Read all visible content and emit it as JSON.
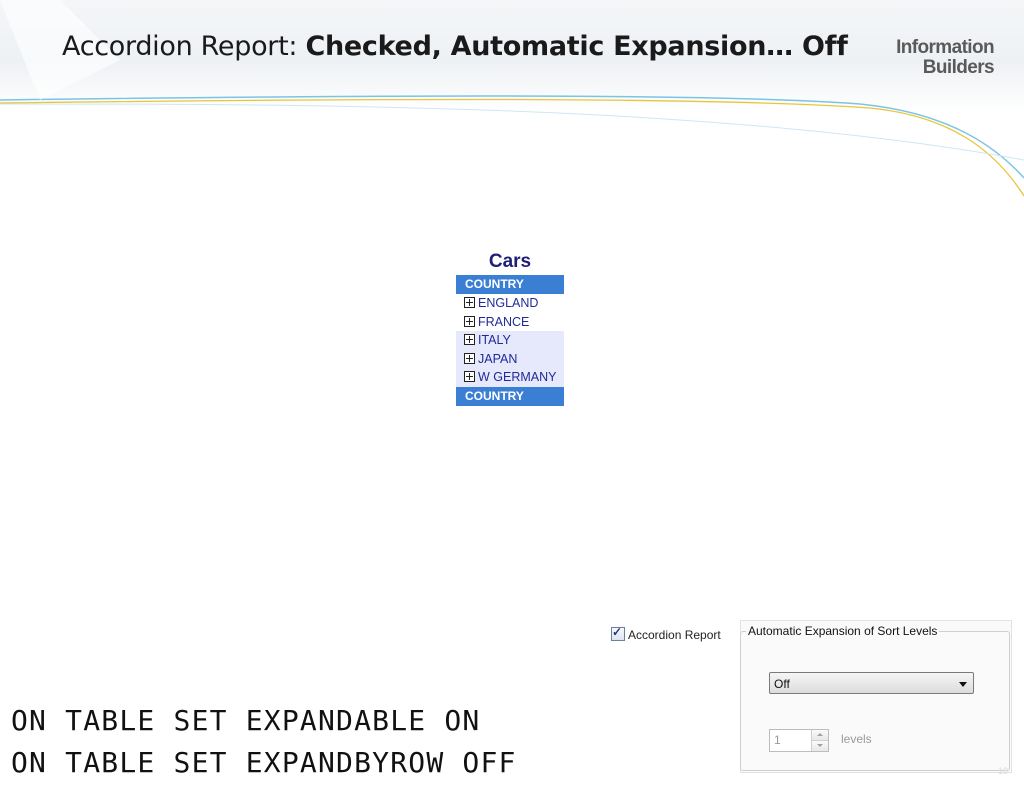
{
  "slide": {
    "title_regular": "Accordion Report: ",
    "title_bold": "Checked, Automatic Expansion… Off",
    "logo": [
      "Information",
      "Builders"
    ],
    "page_number": "18"
  },
  "report": {
    "title": "Cars",
    "header_label": "COUNTRY",
    "footer_label": "COUNTRY",
    "rows": [
      {
        "label": "ENGLAND"
      },
      {
        "label": "FRANCE"
      },
      {
        "label": "ITALY"
      },
      {
        "label": "JAPAN"
      },
      {
        "label": "W GERMANY"
      }
    ]
  },
  "settings": {
    "accordion_checkbox_label": "Accordion Report",
    "accordion_checked": true,
    "group_title": "Automatic Expansion of Sort Levels",
    "expansion_value": "Off",
    "levels_value": "1",
    "levels_label": "levels"
  },
  "code_lines": [
    "ON TABLE SET EXPANDABLE ON",
    "ON TABLE SET EXPANDBYROW OFF"
  ],
  "colors": {
    "header_blue": "#3b7fd4",
    "row_text": "#1f2a9a",
    "title_navy": "#1f1f7a",
    "alt_row": "#e6e8fb"
  }
}
